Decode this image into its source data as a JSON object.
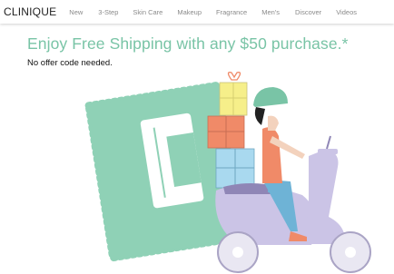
{
  "brand": {
    "logo_text": "CLINIQUE"
  },
  "nav": {
    "items": [
      "New",
      "3-Step",
      "Skin Care",
      "Makeup",
      "Fragrance",
      "Men's",
      "Discover",
      "Videos"
    ]
  },
  "promo": {
    "headline": "Enjoy Free Shipping with any $50 purchase.*",
    "subtext": "No offer code needed.",
    "illustration": "scooter-rider-with-gift-boxes-and-clinique-stamp",
    "colors": {
      "headline": "#79c4a6",
      "stamp": "#8fd1b6",
      "scooter": "#cbc4e6",
      "box_yellow": "#f6ef8a",
      "box_orange": "#f08a68",
      "box_blue": "#a9d9ef"
    }
  }
}
